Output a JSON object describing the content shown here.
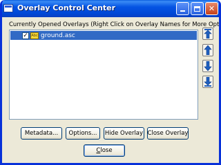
{
  "window": {
    "title": "Overlay Control Center",
    "controls": [
      "minimize-icon",
      "maximize-icon",
      "close-icon"
    ]
  },
  "caption": "Currently Opened Overlays (Right Click on Overlay Names for More Options)",
  "overlays": [
    {
      "name": "ground.asc",
      "checked": true,
      "selected": true,
      "icon": "overlay-layer-icon"
    }
  ],
  "order_buttons": [
    {
      "name": "move-to-top-icon"
    },
    {
      "name": "move-up-icon"
    },
    {
      "name": "move-down-icon"
    },
    {
      "name": "move-to-bottom-icon"
    }
  ],
  "actions": {
    "metadata": "Metadata...",
    "options": "Options...",
    "hide_overlay": "Hide Overlay",
    "close_overlay": "Close Overlay"
  },
  "close_button": {
    "mnemonic": "C",
    "rest": "lose"
  },
  "colors": {
    "titlebar": "#0554e3",
    "selection": "#316ac5",
    "window_bg": "#ece9d8",
    "arrow": "#1f5fbf"
  }
}
